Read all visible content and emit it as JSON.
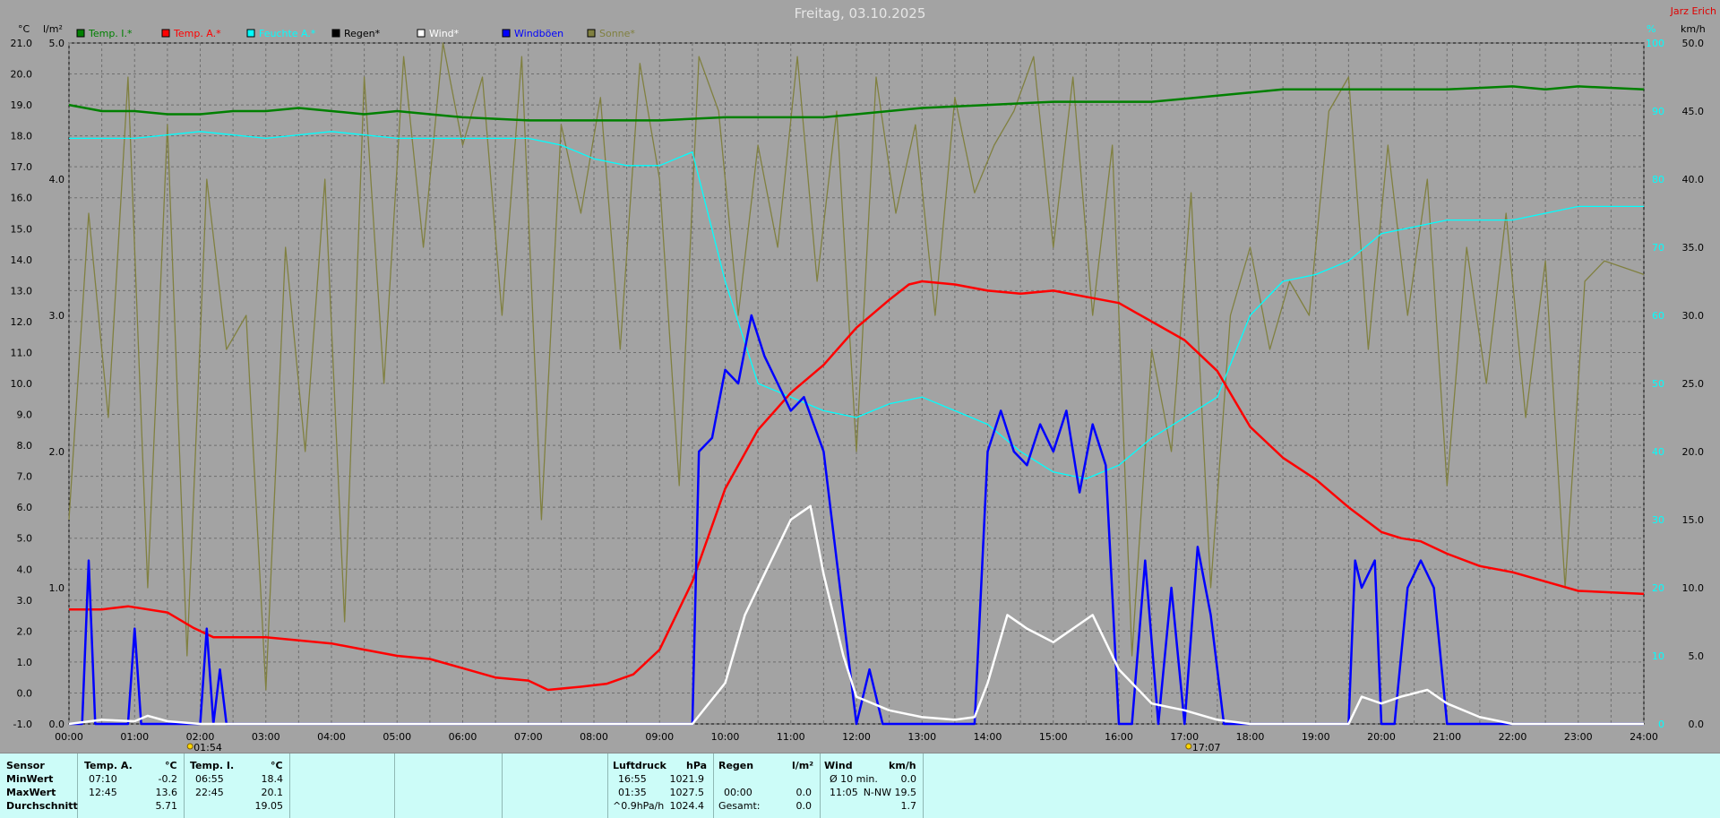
{
  "page": {
    "title": "Freitag, 03.10.2025",
    "author": "Jarz Erich"
  },
  "axes": {
    "temp_unit": "°C",
    "rain_unit": "l/m²",
    "pct_unit": "%",
    "wind_unit": "km/h",
    "temp_ticks": [
      "21.0",
      "20.0",
      "19.0",
      "18.0",
      "17.0",
      "16.0",
      "15.0",
      "14.0",
      "13.0",
      "12.0",
      "11.0",
      "10.0",
      "9.0",
      "8.0",
      "7.0",
      "6.0",
      "5.0",
      "4.0",
      "3.0",
      "2.0",
      "1.0",
      "0.0",
      "-1.0"
    ],
    "rain_ticks": [
      "5.0",
      "4.0",
      "3.0",
      "2.0",
      "1.0",
      "0.0"
    ],
    "pct_ticks": [
      "100",
      "90",
      "80",
      "70",
      "60",
      "50",
      "40",
      "30",
      "20",
      "10",
      "0"
    ],
    "wind_ticks": [
      "50.0",
      "45.0",
      "40.0",
      "35.0",
      "30.0",
      "25.0",
      "20.0",
      "15.0",
      "10.0",
      "5.0",
      "0.0"
    ],
    "time_ticks": [
      "00:00",
      "01:00",
      "02:00",
      "03:00",
      "04:00",
      "05:00",
      "06:00",
      "07:00",
      "08:00",
      "09:00",
      "10:00",
      "11:00",
      "12:00",
      "13:00",
      "14:00",
      "15:00",
      "16:00",
      "17:00",
      "18:00",
      "19:00",
      "20:00",
      "21:00",
      "22:00",
      "23:00",
      "24:00"
    ],
    "sunrise": "01:54",
    "sunset": "17:07"
  },
  "legend": [
    {
      "label": "Temp. I.*",
      "color": "#008000"
    },
    {
      "label": "Temp. A.*",
      "color": "#ff0000"
    },
    {
      "label": "Feuchte A.*",
      "color": "#00ffff"
    },
    {
      "label": "Regen*",
      "color": "#000000"
    },
    {
      "label": "Wind*",
      "color": "#ffffff"
    },
    {
      "label": "Windböen",
      "color": "#0000ff"
    },
    {
      "label": "Sonne*",
      "color": "#808040"
    }
  ],
  "chart_data": {
    "type": "line",
    "title": "Freitag, 03.10.2025",
    "x_unit": "hours",
    "xlim": [
      0,
      24
    ],
    "ylim_temp": [
      -1,
      21
    ],
    "ylim_rain": [
      0,
      5
    ],
    "ylim_pct": [
      0,
      100
    ],
    "ylim_wind": [
      0,
      50
    ],
    "grid": true,
    "legend_position": "top",
    "series": [
      {
        "name": "Temp. I.*",
        "axis": "temp",
        "color": "#008000",
        "x": [
          0,
          0.5,
          1,
          1.5,
          2,
          2.5,
          3,
          3.5,
          4,
          4.5,
          5,
          5.5,
          6,
          7,
          8,
          9,
          10,
          11,
          11.5,
          12,
          13,
          14,
          15,
          16,
          16.5,
          17,
          18,
          18.5,
          19,
          20,
          21,
          22,
          22.5,
          23,
          24
        ],
        "y": [
          19.0,
          18.8,
          18.8,
          18.7,
          18.7,
          18.8,
          18.8,
          18.9,
          18.8,
          18.7,
          18.8,
          18.7,
          18.6,
          18.5,
          18.5,
          18.5,
          18.6,
          18.6,
          18.6,
          18.7,
          18.9,
          19.0,
          19.1,
          19.1,
          19.1,
          19.2,
          19.4,
          19.5,
          19.5,
          19.5,
          19.5,
          19.6,
          19.5,
          19.6,
          19.5
        ]
      },
      {
        "name": "Temp. A.*",
        "axis": "temp",
        "color": "#ff0000",
        "x": [
          0,
          0.5,
          0.9,
          1.5,
          1.9,
          2.2,
          2.5,
          3,
          4,
          4.5,
          5,
          5.5,
          6,
          6.5,
          7,
          7.3,
          7.8,
          8.2,
          8.6,
          9,
          9.5,
          10,
          10.5,
          11,
          11.5,
          12,
          12.5,
          12.8,
          13,
          13.5,
          14,
          14.5,
          15,
          15.5,
          16,
          16.5,
          17,
          17.5,
          18,
          18.5,
          19,
          19.5,
          20,
          20.3,
          20.6,
          21,
          21.5,
          22,
          22.5,
          23,
          24
        ],
        "y": [
          2.7,
          2.7,
          2.8,
          2.6,
          2.1,
          1.8,
          1.8,
          1.8,
          1.6,
          1.4,
          1.2,
          1.1,
          0.8,
          0.5,
          0.4,
          0.1,
          0.2,
          0.3,
          0.6,
          1.4,
          3.6,
          6.6,
          8.5,
          9.7,
          10.6,
          11.8,
          12.7,
          13.2,
          13.3,
          13.2,
          13.0,
          12.9,
          13.0,
          12.8,
          12.6,
          12.0,
          11.4,
          10.4,
          8.6,
          7.6,
          6.9,
          6.0,
          5.2,
          5.0,
          4.9,
          4.5,
          4.1,
          3.9,
          3.6,
          3.3,
          3.2
        ]
      },
      {
        "name": "Feuchte A.*",
        "axis": "pct",
        "color": "#00ffff",
        "x": [
          0,
          1,
          2,
          3,
          4,
          5,
          6,
          7,
          7.5,
          8,
          8.5,
          9,
          9.5,
          10,
          10.5,
          11,
          11.5,
          12,
          12.5,
          13,
          13.5,
          14,
          14.5,
          15,
          15.5,
          16,
          16.5,
          17,
          17.5,
          18,
          18.5,
          19,
          19.5,
          20,
          21,
          22,
          23,
          24
        ],
        "y": [
          86,
          86,
          87,
          86,
          87,
          86,
          86,
          86,
          85,
          83,
          82,
          82,
          84,
          65,
          50,
          48,
          46,
          45,
          47,
          48,
          46,
          44,
          40,
          37,
          36,
          38,
          42,
          45,
          48,
          60,
          65,
          66,
          68,
          72,
          74,
          74,
          76,
          76
        ]
      },
      {
        "name": "Wind*",
        "axis": "wind",
        "color": "#ffffff",
        "x": [
          0,
          0.5,
          1,
          1.2,
          1.5,
          2,
          3,
          9,
          9.5,
          10,
          10.3,
          10.6,
          11,
          11.3,
          11.5,
          11.8,
          12,
          12.5,
          13,
          13.5,
          13.8,
          14,
          14.3,
          14.6,
          15,
          15.3,
          15.6,
          16,
          16.5,
          17,
          17.5,
          18,
          19,
          19.5,
          19.7,
          20,
          20.3,
          20.7,
          21,
          21.5,
          22,
          24
        ],
        "y": [
          0,
          0.3,
          0.2,
          0.6,
          0.2,
          0,
          0,
          0,
          0,
          3,
          8,
          11,
          15,
          16,
          11,
          5,
          2,
          1,
          0.5,
          0.3,
          0.5,
          3,
          8,
          7,
          6,
          7,
          8,
          4,
          1.5,
          1,
          0.3,
          0,
          0,
          0,
          2,
          1.5,
          2,
          2.5,
          1.5,
          0.5,
          0,
          0
        ]
      },
      {
        "name": "Windböen",
        "axis": "wind",
        "color": "#0000ff",
        "x": [
          0,
          0.2,
          0.3,
          0.4,
          0.9,
          1.0,
          1.1,
          2.0,
          2.1,
          2.2,
          2.3,
          2.4,
          9.5,
          9.6,
          9.8,
          10.0,
          10.2,
          10.4,
          10.6,
          10.8,
          11,
          11.2,
          11.5,
          11.7,
          12.0,
          12.2,
          12.4,
          13.5,
          13.8,
          14.0,
          14.2,
          14.4,
          14.6,
          14.8,
          15,
          15.2,
          15.4,
          15.6,
          15.8,
          16.0,
          16.2,
          16.4,
          16.6,
          16.8,
          17.0,
          17.2,
          17.4,
          17.6,
          19.5,
          19.6,
          19.7,
          19.9,
          20.0,
          20.2,
          20.4,
          20.6,
          20.8,
          21.0,
          21.2,
          21.5,
          22,
          24
        ],
        "y": [
          0,
          0,
          12,
          0,
          0,
          7,
          0,
          0,
          7,
          0,
          4,
          0,
          0,
          20,
          21,
          26,
          25,
          30,
          27,
          25,
          23,
          24,
          20,
          12,
          0,
          4,
          0,
          0,
          0,
          20,
          23,
          20,
          19,
          22,
          20,
          23,
          17,
          22,
          19,
          0,
          0,
          12,
          0,
          10,
          0,
          13,
          8,
          0,
          0,
          12,
          10,
          12,
          0,
          0,
          10,
          12,
          10,
          0,
          0,
          0,
          0,
          0
        ]
      },
      {
        "name": "Sonne*",
        "axis": "pct",
        "color": "#808040",
        "x": [
          0,
          0.3,
          0.6,
          0.9,
          1.2,
          1.5,
          1.8,
          2.1,
          2.4,
          2.7,
          3.0,
          3.3,
          3.6,
          3.9,
          4.2,
          4.5,
          4.8,
          5.1,
          5.4,
          5.7,
          6.0,
          6.3,
          6.6,
          6.9,
          7.2,
          7.5,
          7.8,
          8.1,
          8.4,
          8.7,
          9.0,
          9.3,
          9.6,
          9.9,
          10.2,
          10.5,
          10.8,
          11.1,
          11.4,
          11.7,
          12.0,
          12.3,
          12.6,
          12.9,
          13.2,
          13.5,
          13.8,
          14.1,
          14.4,
          14.7,
          15.0,
          15.3,
          15.6,
          15.9,
          16.2,
          16.5,
          16.8,
          17.1,
          17.4,
          17.7,
          18.0,
          18.3,
          18.6,
          18.9,
          19.2,
          19.5,
          19.8,
          20.1,
          20.4,
          20.7,
          21.0,
          21.3,
          21.6,
          21.9,
          22.2,
          22.5,
          22.8,
          23.1,
          23.4,
          23.7,
          24
        ],
        "y": [
          30,
          75,
          45,
          95,
          20,
          88,
          10,
          80,
          55,
          60,
          5,
          70,
          40,
          80,
          15,
          95,
          50,
          98,
          70,
          100,
          85,
          95,
          60,
          98,
          30,
          88,
          75,
          92,
          55,
          97,
          80,
          35,
          98,
          90,
          60,
          85,
          70,
          98,
          65,
          90,
          40,
          95,
          75,
          88,
          60,
          92,
          78,
          85,
          90,
          98,
          70,
          95,
          60,
          85,
          10,
          55,
          40,
          78,
          20,
          60,
          70,
          55,
          65,
          60,
          90,
          95,
          55,
          85,
          60,
          80,
          35,
          70,
          50,
          75,
          45,
          68,
          20,
          65,
          68,
          67,
          66
        ]
      }
    ]
  },
  "table": {
    "sensor": {
      "header": "Sensor",
      "rows": [
        "MinWert",
        "MaxWert",
        "Durchschnitt"
      ]
    },
    "temp_a": {
      "header": "Temp. A.",
      "unit": "°C",
      "min_time": "07:10",
      "min_val": "-0.2",
      "max_time": "12:45",
      "max_val": "13.6",
      "avg": "5.71"
    },
    "temp_i": {
      "header": "Temp. I.",
      "unit": "°C",
      "min_time": "06:55",
      "min_val": "18.4",
      "max_time": "22:45",
      "max_val": "20.1",
      "avg": "19.05"
    },
    "pressure": {
      "header": "Luftdruck",
      "unit": "hPa",
      "min_time": "16:55",
      "min_val": "1021.9",
      "max_time": "01:35",
      "max_val": "1027.5",
      "trend_label": "^0.9hPa/h",
      "trend_val": "1024.4"
    },
    "rain": {
      "header": "Regen",
      "unit": "l/m²",
      "max_time": "00:00",
      "max_val": "0.0",
      "total_label": "Gesamt:",
      "total_val": "0.0"
    },
    "wind": {
      "header": "Wind",
      "unit": "km/h",
      "avg_label": "Ø 10 min.",
      "avg_val": "0.0",
      "max_time": "11:05",
      "max_dir_val": "N-NW 19.5",
      "mean": "1.7"
    }
  }
}
